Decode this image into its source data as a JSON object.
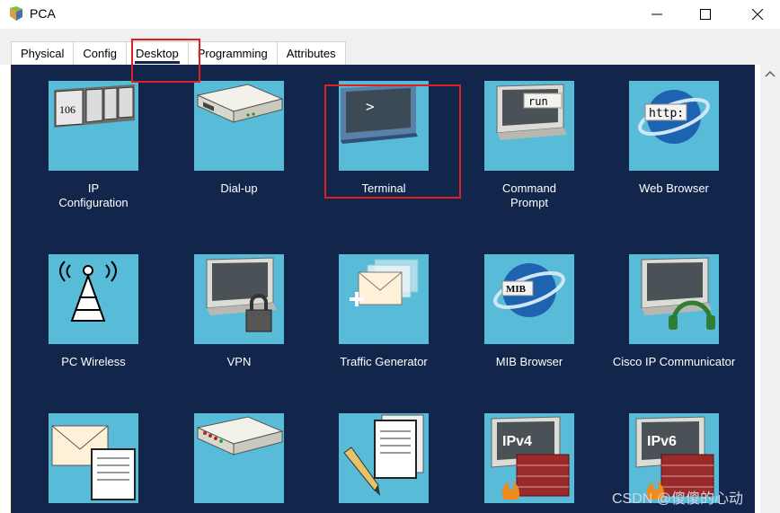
{
  "window": {
    "title": "PCA"
  },
  "tabs": [
    {
      "label": "Physical"
    },
    {
      "label": "Config"
    },
    {
      "label": "Desktop"
    },
    {
      "label": "Programming"
    },
    {
      "label": "Attributes"
    }
  ],
  "active_tab": "Desktop",
  "apps": [
    {
      "label": "IP\nConfiguration"
    },
    {
      "label": "Dial-up"
    },
    {
      "label": "Terminal"
    },
    {
      "label": "Command\nPrompt"
    },
    {
      "label": "Web Browser"
    },
    {
      "label": "PC Wireless"
    },
    {
      "label": "VPN"
    },
    {
      "label": "Traffic Generator"
    },
    {
      "label": "MIB Browser"
    },
    {
      "label": "Cisco IP Communicator"
    },
    {
      "label": ""
    },
    {
      "label": ""
    },
    {
      "label": ""
    },
    {
      "label": ""
    },
    {
      "label": ""
    }
  ],
  "icon_text": {
    "ip_config": "106",
    "terminal": ">",
    "cmd": "run",
    "web": "http:",
    "mib": "MIB",
    "ipv4": "IPv4",
    "ipv6": "IPv6"
  },
  "watermark": "CSDN @傻傻的心动",
  "colors": {
    "panel": "#12264c",
    "tile": "#58bcd8",
    "highlight": "#e02020"
  }
}
